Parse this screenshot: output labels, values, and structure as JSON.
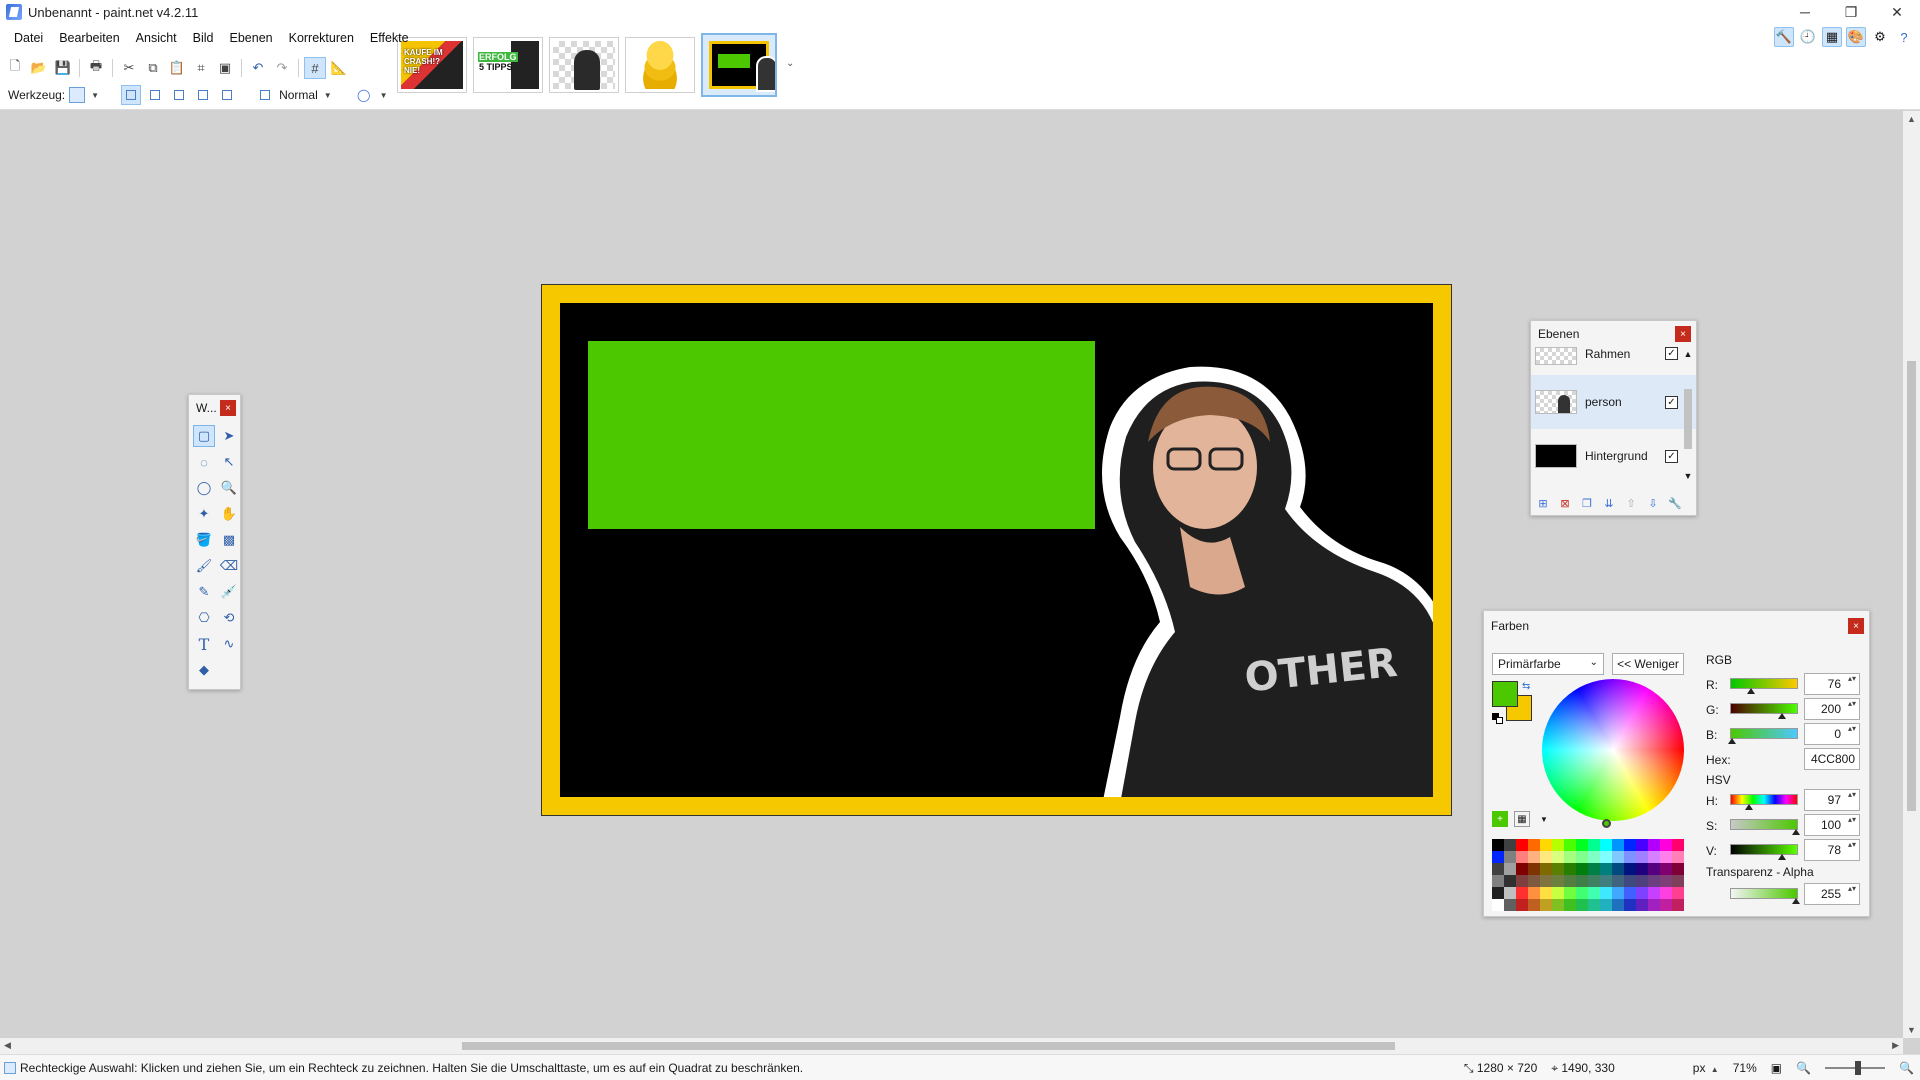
{
  "window": {
    "title": "Unbenannt - paint.net v4.2.11",
    "controls": [
      "─",
      "❐",
      "✕"
    ]
  },
  "menu": [
    "Datei",
    "Bearbeiten",
    "Ansicht",
    "Bild",
    "Ebenen",
    "Korrekturen",
    "Effekte"
  ],
  "thumbnails": {
    "t1_text": "KAUFE IM CRASH!? NIE!",
    "t2_text": "ERFOLG",
    "t2_text2": "5 TIPPS"
  },
  "tool_options": {
    "label": "Werkzeug:",
    "blend_mode": "Normal"
  },
  "tools_window": {
    "title": "W..."
  },
  "layers_window": {
    "title": "Ebenen",
    "layers": [
      {
        "name": "Rahmen",
        "visible": true
      },
      {
        "name": "person",
        "visible": true
      },
      {
        "name": "Hintergrund",
        "visible": true
      }
    ]
  },
  "colors_window": {
    "title": "Farben",
    "select_value": "Primärfarbe",
    "less_button": "<< Weniger",
    "primary_color": "#4CC800",
    "secondary_color": "#F5C800",
    "rgb_header": "RGB",
    "r_label": "R:",
    "r_value": "76",
    "g_label": "G:",
    "g_value": "200",
    "b_label": "B:",
    "b_value": "0",
    "hex_label": "Hex:",
    "hex_value": "4CC800",
    "hsv_header": "HSV",
    "h_label": "H:",
    "h_value": "97",
    "s_label": "S:",
    "s_value": "100",
    "v_label": "V:",
    "v_value": "78",
    "alpha_header": "Transparenz - Alpha",
    "alpha_value": "255"
  },
  "canvas": {
    "frame_color": "#F5C800",
    "background_color": "#000000",
    "rect_color": "#4CC800",
    "shirt_text": "OTHER"
  },
  "status": {
    "hint": "Rechteckige Auswahl: Klicken und ziehen Sie, um ein Rechteck zu zeichnen. Halten Sie die Umschalttaste, um es auf ein Quadrat zu beschränken.",
    "image_size": "1280 × 720",
    "cursor_pos": "1490, 330",
    "unit": "px",
    "zoom": "71%"
  }
}
